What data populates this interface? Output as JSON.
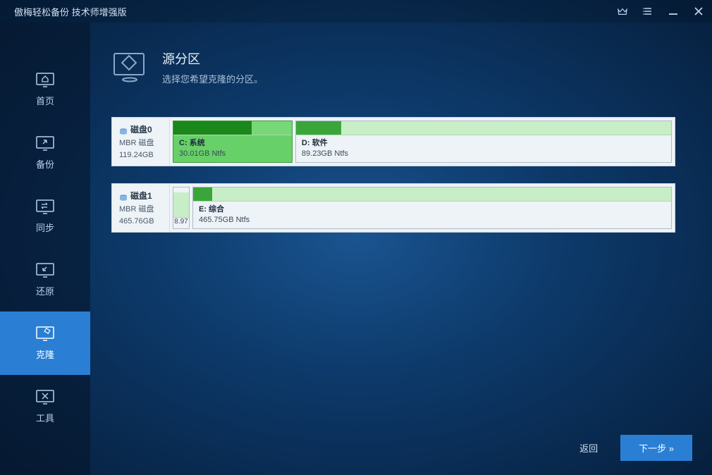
{
  "app": {
    "title": "傲梅轻松备份 技术师增强版"
  },
  "sidebar": {
    "items": [
      {
        "label": "首页"
      },
      {
        "label": "备份"
      },
      {
        "label": "同步"
      },
      {
        "label": "还原"
      },
      {
        "label": "克隆"
      },
      {
        "label": "工具"
      }
    ]
  },
  "page": {
    "title": "源分区",
    "subtitle": "选择您希望克隆的分区。"
  },
  "disks": [
    {
      "name": "磁盘0",
      "type": "MBR 磁盘",
      "size": "119.24GB",
      "partitions": [
        {
          "label": "C: 系统",
          "detail": "30.01GB Ntfs",
          "usage_pct": 66,
          "width_pct": 24,
          "selected": true
        },
        {
          "label": "D: 软件",
          "detail": "89.23GB Ntfs",
          "usage_pct": 12,
          "width_pct": 76,
          "selected": false
        }
      ]
    },
    {
      "name": "磁盘1",
      "type": "MBR 磁盘",
      "size": "465.76GB",
      "partitions": [
        {
          "label": "8.97",
          "detail": "",
          "usage_pct": 0,
          "width_pct": 0,
          "tiny": true
        },
        {
          "label": "E: 综合",
          "detail": "465.75GB Ntfs",
          "usage_pct": 4,
          "width_pct": 100,
          "selected": false
        }
      ]
    }
  ],
  "footer": {
    "back": "返回",
    "next": "下一步 »"
  }
}
